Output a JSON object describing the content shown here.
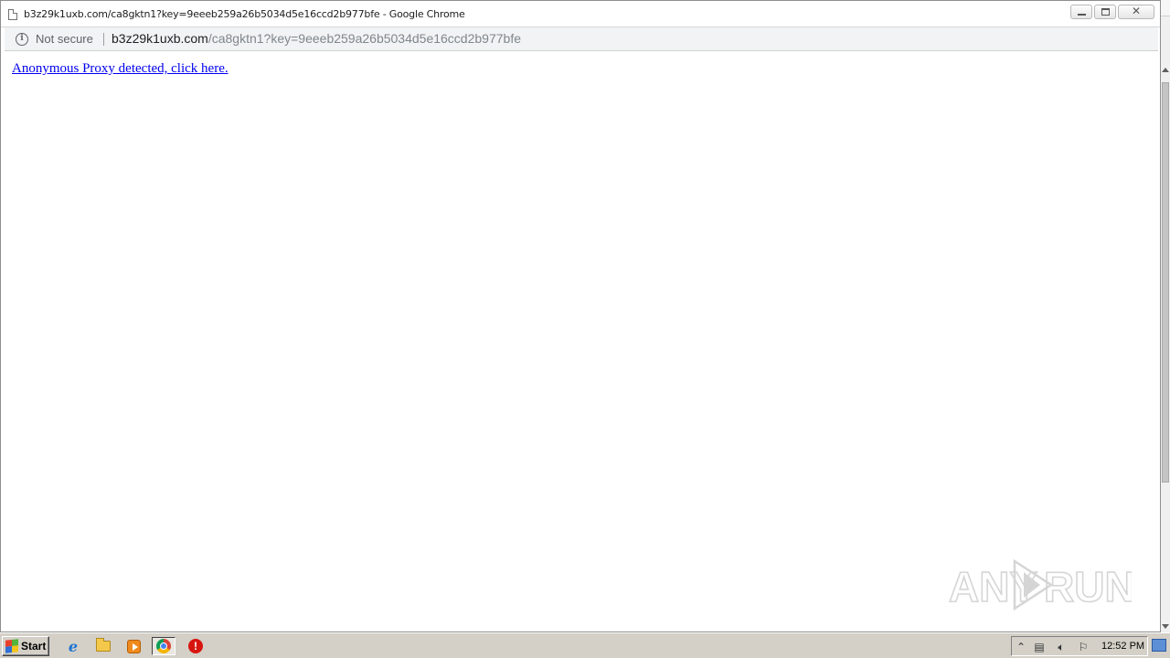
{
  "window": {
    "title": "b3z29k1uxb.com/ca8gktn1?key=9eeeb259a26b5034d5e16ccd2b977bfe - Google Chrome",
    "controls": {
      "close_glyph": "✕"
    }
  },
  "addressbar": {
    "security_label": "Not secure",
    "url_host": "b3z29k1uxb.com",
    "url_path": "/ca8gktn1?key=9eeeb259a26b5034d5e16ccd2b977bfe",
    "info_glyph": "i"
  },
  "content": {
    "link_text": "Anonymous Proxy detected, click here."
  },
  "watermark": {
    "text_left": "ANY",
    "text_right": "RUN"
  },
  "taskbar": {
    "start_label": "Start",
    "icons": [
      "internet-explorer-icon",
      "folder-icon",
      "media-player-icon",
      "chrome-icon",
      "stop-icon"
    ],
    "ie_glyph": "e",
    "stop_glyph": "!",
    "clock": "12:52 PM"
  },
  "tray": {
    "arrow_glyph": "⌃",
    "network_glyph": "▤",
    "volume_glyph": "🔈︎",
    "flag_glyph": "⚐"
  }
}
